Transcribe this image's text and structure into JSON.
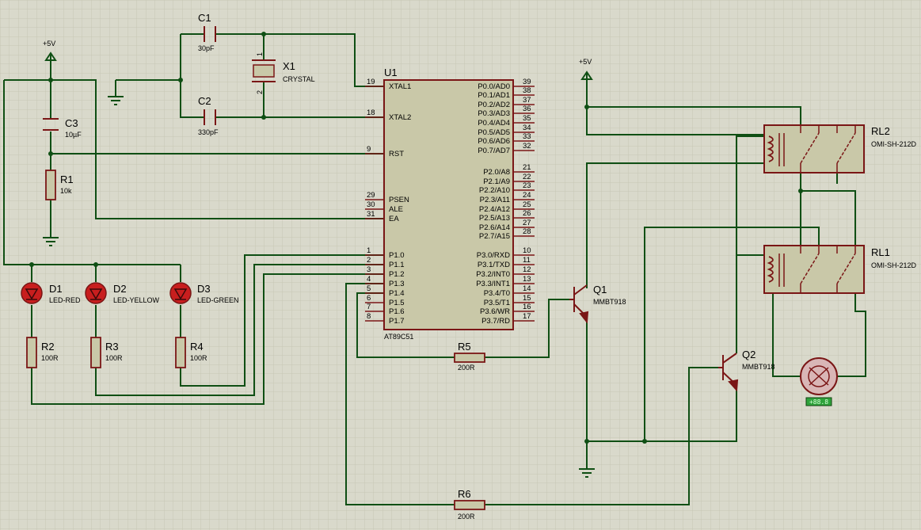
{
  "colors": {
    "background": "#d9d9cb",
    "grid": "#c9c9b8",
    "wire": "#0f4f14",
    "component": "#7a1616",
    "chip_fill": "#c9c8a8",
    "led_fill": "#c81e1e",
    "motor_fill": "#d9b6b6",
    "badge": "#2fa33c"
  },
  "power": {
    "vcc_label_left": "+5V",
    "vcc_label_right": "+5V"
  },
  "u1": {
    "ref": "U1",
    "part": "AT89C51",
    "left_pins": [
      {
        "num": "19",
        "name": "XTAL1"
      },
      {
        "num": "18",
        "name": "XTAL2"
      },
      {
        "num": "9",
        "name": "RST"
      },
      {
        "num": "29",
        "name": "PSEN"
      },
      {
        "num": "30",
        "name": "ALE"
      },
      {
        "num": "31",
        "name": "EA"
      },
      {
        "num": "1",
        "name": "P1.0"
      },
      {
        "num": "2",
        "name": "P1.1"
      },
      {
        "num": "3",
        "name": "P1.2"
      },
      {
        "num": "4",
        "name": "P1.3"
      },
      {
        "num": "5",
        "name": "P1.4"
      },
      {
        "num": "6",
        "name": "P1.5"
      },
      {
        "num": "7",
        "name": "P1.6"
      },
      {
        "num": "8",
        "name": "P1.7"
      }
    ],
    "right_pins": [
      {
        "num": "39",
        "name": "P0.0/AD0"
      },
      {
        "num": "38",
        "name": "P0.1/AD1"
      },
      {
        "num": "37",
        "name": "P0.2/AD2"
      },
      {
        "num": "36",
        "name": "P0.3/AD3"
      },
      {
        "num": "35",
        "name": "P0.4/AD4"
      },
      {
        "num": "34",
        "name": "P0.5/AD5"
      },
      {
        "num": "33",
        "name": "P0.6/AD6"
      },
      {
        "num": "32",
        "name": "P0.7/AD7"
      },
      {
        "num": "21",
        "name": "P2.0/A8"
      },
      {
        "num": "22",
        "name": "P2.1/A9"
      },
      {
        "num": "23",
        "name": "P2.2/A10"
      },
      {
        "num": "24",
        "name": "P2.3/A11"
      },
      {
        "num": "25",
        "name": "P2.4/A12"
      },
      {
        "num": "26",
        "name": "P2.5/A13"
      },
      {
        "num": "27",
        "name": "P2.6/A14"
      },
      {
        "num": "28",
        "name": "P2.7/A15"
      },
      {
        "num": "10",
        "name": "P3.0/RXD"
      },
      {
        "num": "11",
        "name": "P3.1/TXD"
      },
      {
        "num": "12",
        "name": "P3.2/INT0"
      },
      {
        "num": "13",
        "name": "P3.3/INT1"
      },
      {
        "num": "14",
        "name": "P3.4/T0"
      },
      {
        "num": "15",
        "name": "P3.5/T1"
      },
      {
        "num": "16",
        "name": "P3.6/WR"
      },
      {
        "num": "17",
        "name": "P3.7/RD"
      }
    ]
  },
  "c1": {
    "ref": "C1",
    "value": "30pF"
  },
  "c2": {
    "ref": "C2",
    "value": "330pF"
  },
  "c3": {
    "ref": "C3",
    "value": "10µF"
  },
  "x1": {
    "ref": "X1",
    "value": "CRYSTAL",
    "pin1": "1",
    "pin2": "2"
  },
  "r1": {
    "ref": "R1",
    "value": "10k"
  },
  "r2": {
    "ref": "R2",
    "value": "100R"
  },
  "r3": {
    "ref": "R3",
    "value": "100R"
  },
  "r4": {
    "ref": "R4",
    "value": "100R"
  },
  "r5": {
    "ref": "R5",
    "value": "200R"
  },
  "r6": {
    "ref": "R6",
    "value": "200R"
  },
  "d1": {
    "ref": "D1",
    "value": "LED-RED"
  },
  "d2": {
    "ref": "D2",
    "value": "LED-YELLOW"
  },
  "d3": {
    "ref": "D3",
    "value": "LED-GREEN"
  },
  "q1": {
    "ref": "Q1",
    "value": "MMBT918"
  },
  "q2": {
    "ref": "Q2",
    "value": "MMBT918"
  },
  "rl1": {
    "ref": "RL1",
    "value": "OMI-SH-212D"
  },
  "rl2": {
    "ref": "RL2",
    "value": "OMI-SH-212D"
  },
  "motor": {
    "readout": "+88.8"
  }
}
